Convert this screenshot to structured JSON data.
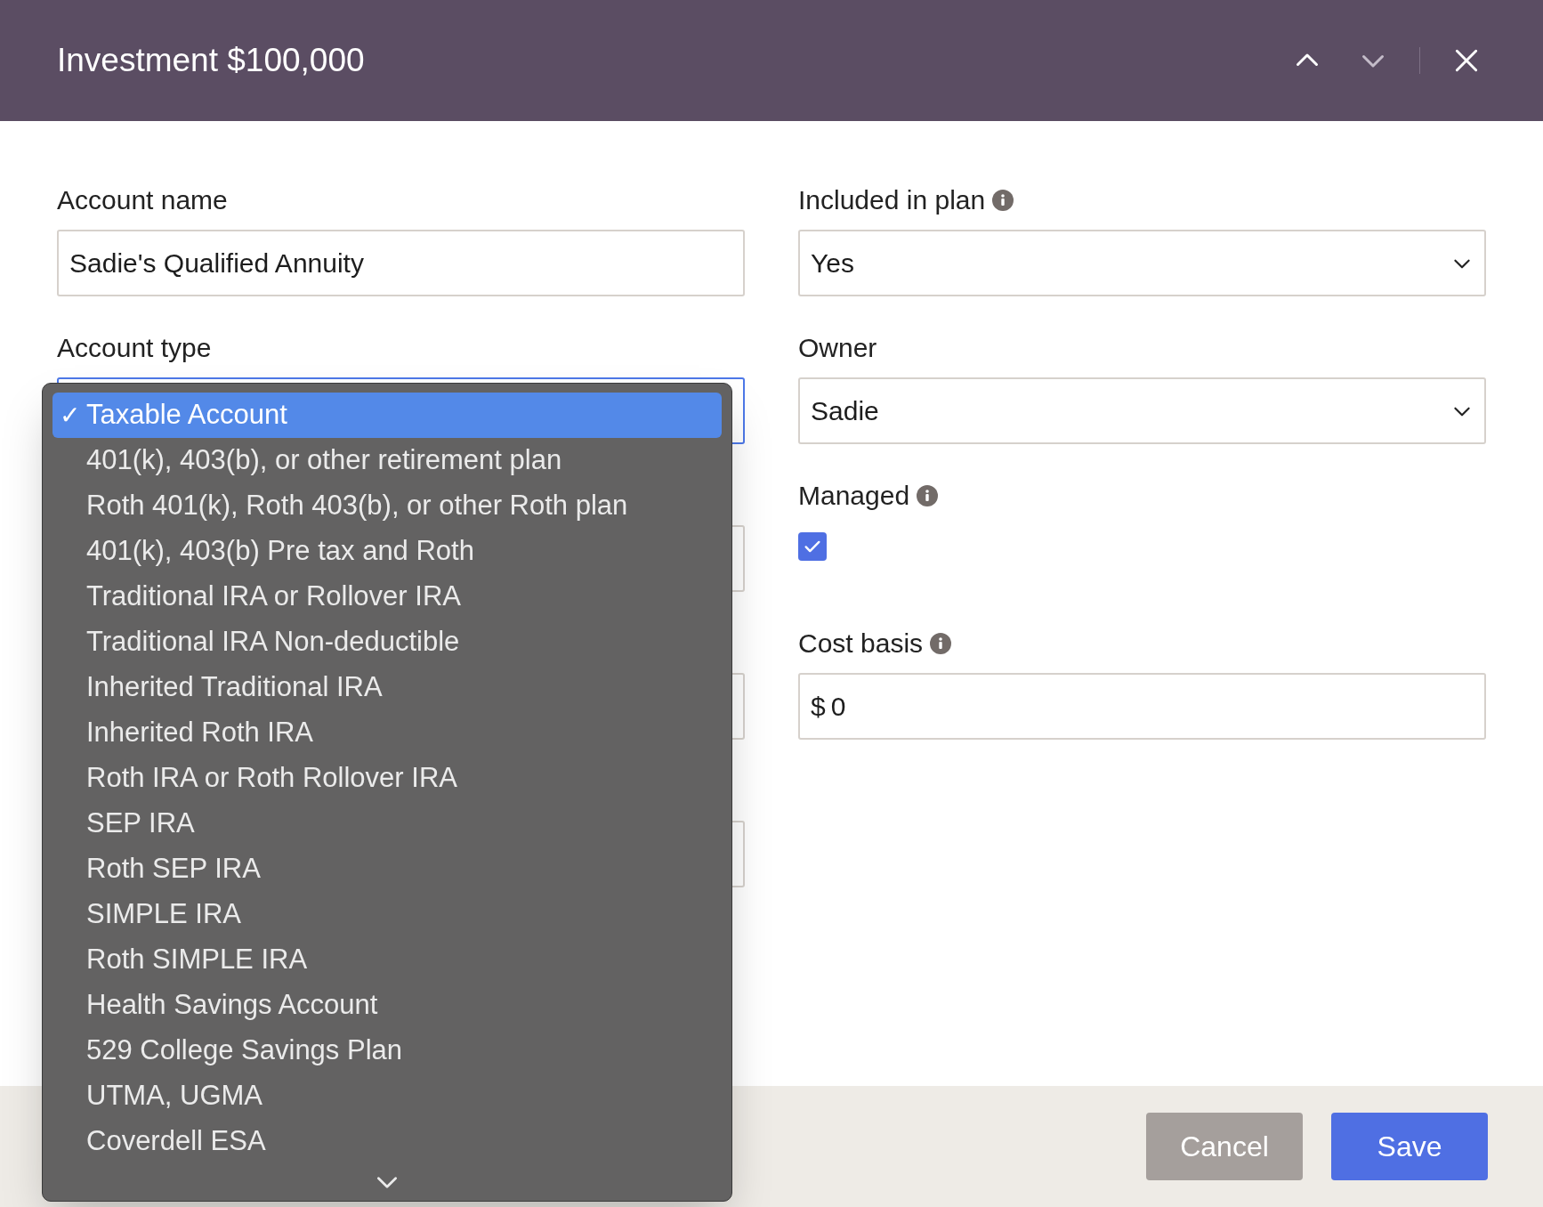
{
  "dialog": {
    "title": "Investment $100,000",
    "nav": [
      {
        "kind": "previous",
        "disabled": false
      },
      {
        "kind": "next",
        "disabled": true
      }
    ]
  },
  "left_fields": [
    {
      "kind": "text",
      "label": "Account name",
      "value": "Sadie's Qualified Annuity"
    },
    {
      "kind": "select_open",
      "label": "Account type"
    },
    {
      "kind": "hidden"
    },
    {
      "kind": "hidden"
    },
    {
      "kind": "hidden"
    }
  ],
  "right_fields": [
    {
      "kind": "select",
      "label": "Included in plan",
      "info": true,
      "value": "Yes"
    },
    {
      "kind": "select",
      "label": "Owner",
      "info": false,
      "value": "Sadie"
    },
    {
      "kind": "checkbox",
      "label": "Managed",
      "info": true,
      "checked": true
    },
    {
      "kind": "money",
      "label": "Cost basis",
      "info": true,
      "prefix": "$",
      "value": "0"
    }
  ],
  "dropdown": {
    "options": [
      {
        "label": "Taxable Account",
        "selected": true
      },
      {
        "label": "401(k), 403(b), or other retirement plan",
        "selected": false
      },
      {
        "label": "Roth 401(k), Roth 403(b), or other Roth plan",
        "selected": false
      },
      {
        "label": "401(k), 403(b) Pre tax and Roth",
        "selected": false
      },
      {
        "label": "Traditional IRA or Rollover IRA",
        "selected": false
      },
      {
        "label": "Traditional IRA Non-deductible",
        "selected": false
      },
      {
        "label": "Inherited Traditional IRA",
        "selected": false
      },
      {
        "label": "Inherited Roth IRA",
        "selected": false
      },
      {
        "label": "Roth IRA or Roth Rollover IRA",
        "selected": false
      },
      {
        "label": "SEP IRA",
        "selected": false
      },
      {
        "label": "Roth SEP IRA",
        "selected": false
      },
      {
        "label": "SIMPLE IRA",
        "selected": false
      },
      {
        "label": "Roth SIMPLE IRA",
        "selected": false
      },
      {
        "label": "Health Savings Account",
        "selected": false
      },
      {
        "label": "529 College Savings Plan",
        "selected": false
      },
      {
        "label": "UTMA, UGMA",
        "selected": false
      },
      {
        "label": "Coverdell ESA",
        "selected": false
      }
    ],
    "check_mark": "✓"
  },
  "buttons": [
    {
      "label": "Cancel",
      "kind": "secondary"
    },
    {
      "label": "Save",
      "kind": "primary"
    }
  ]
}
